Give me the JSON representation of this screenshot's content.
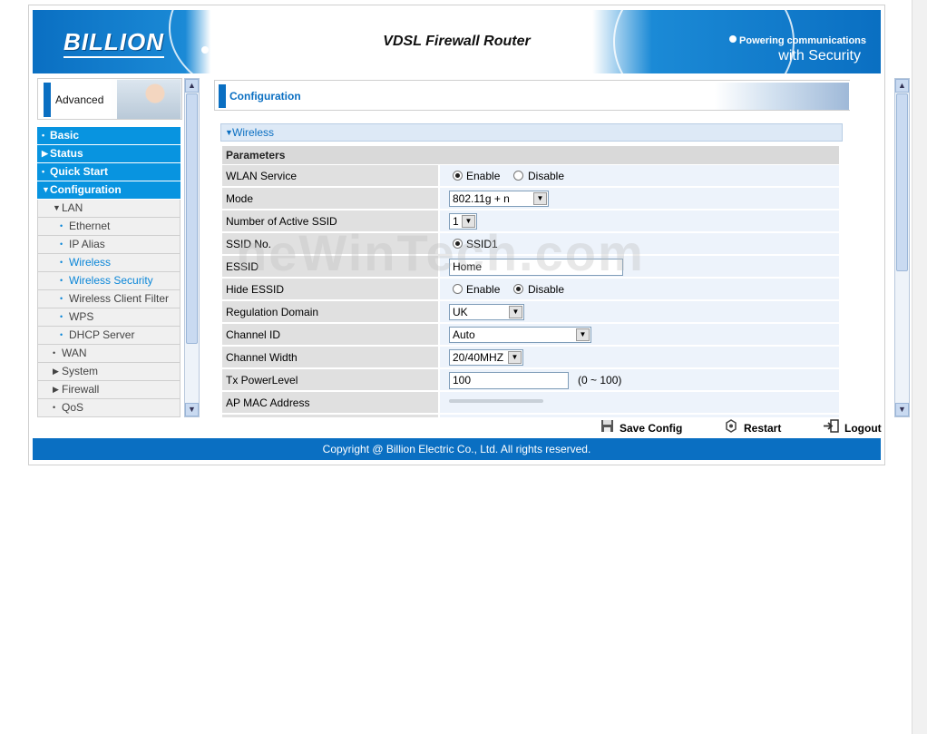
{
  "banner": {
    "logo": "BILLION",
    "title": "VDSL Firewall Router",
    "slogan_line1": "Powering communications",
    "slogan_line2": "with Security"
  },
  "left": {
    "advanced_label": "Advanced",
    "nav": [
      {
        "label": "Basic",
        "level": "top",
        "marker": "•"
      },
      {
        "label": "Status",
        "level": "top",
        "marker": "▶"
      },
      {
        "label": "Quick Start",
        "level": "top",
        "marker": "•"
      },
      {
        "label": "Configuration",
        "level": "top",
        "marker": "▼"
      },
      {
        "label": "LAN",
        "level": "lvl1",
        "marker": "▼"
      },
      {
        "label": "Ethernet",
        "level": "lvl2",
        "marker": "•"
      },
      {
        "label": "IP Alias",
        "level": "lvl2",
        "marker": "•"
      },
      {
        "label": "Wireless",
        "level": "lvl2",
        "marker": "•",
        "selected": true
      },
      {
        "label": "Wireless Security",
        "level": "lvl2",
        "marker": "•",
        "selected": true
      },
      {
        "label": "Wireless Client Filter",
        "level": "lvl2",
        "marker": "•"
      },
      {
        "label": "WPS",
        "level": "lvl2",
        "marker": "•"
      },
      {
        "label": "DHCP Server",
        "level": "lvl2",
        "marker": "•"
      },
      {
        "label": "WAN",
        "level": "lvl1",
        "marker": "•"
      },
      {
        "label": "System",
        "level": "lvl1",
        "marker": "▶"
      },
      {
        "label": "Firewall",
        "level": "lvl1",
        "marker": "▶"
      },
      {
        "label": "QoS",
        "level": "lvl1",
        "marker": "•"
      }
    ]
  },
  "main": {
    "config_title": "Configuration",
    "section_title": "Wireless",
    "params_label": "Parameters",
    "rows": {
      "wlan_service": {
        "label": "WLAN Service",
        "opt1": "Enable",
        "opt2": "Disable"
      },
      "mode": {
        "label": "Mode",
        "value": "802.11g + n"
      },
      "active_ssid": {
        "label": "Number of Active SSID",
        "value": "1"
      },
      "ssid_no": {
        "label": "SSID No.",
        "value": "SSID1"
      },
      "essid": {
        "label": "ESSID",
        "value": "Home"
      },
      "hide_essid": {
        "label": "Hide ESSID",
        "opt1": "Enable",
        "opt2": "Disable"
      },
      "regulation": {
        "label": "Regulation Domain",
        "value": "UK"
      },
      "channel_id": {
        "label": "Channel ID",
        "value": "Auto"
      },
      "channel_width": {
        "label": "Channel Width",
        "value": "20/40MHZ"
      },
      "tx_power": {
        "label": "Tx PowerLevel",
        "value": "100",
        "hint": "(0 ~ 100)"
      },
      "ap_mac": {
        "label": "AP MAC Address"
      }
    },
    "watermark": "neWinTech.com"
  },
  "actions": {
    "save": "Save Config",
    "restart": "Restart",
    "logout": "Logout"
  },
  "footer": "Copyright @ Billion Electric Co., Ltd. All rights reserved.",
  "colors": {
    "accent": "#0a6fc2",
    "nav_top": "#0894e0",
    "selected": "#0a86d8"
  }
}
